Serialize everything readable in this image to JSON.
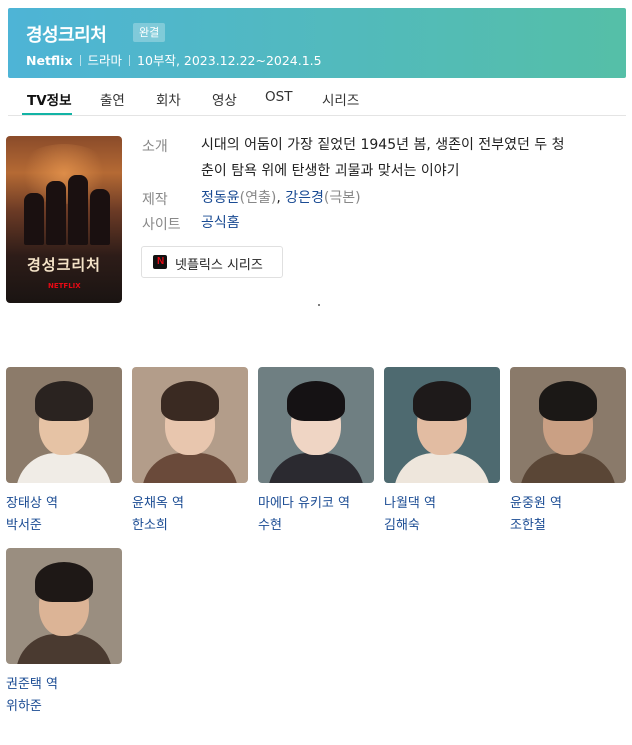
{
  "header": {
    "title": "경성크리처",
    "badge": "완결",
    "platform": "Netflix",
    "genre": "드라마",
    "info": "10부작, 2023.12.22~2024.1.5"
  },
  "tabs": [
    "TV정보",
    "출연",
    "회차",
    "영상",
    "OST",
    "시리즈"
  ],
  "poster": {
    "title": "경성크리처",
    "brand": "NETFLIX"
  },
  "details": {
    "intro_label": "소개",
    "intro_line1": "시대의 어둠이 가장 짙었던 1945년 봄, 생존이 전부였던 두 청",
    "intro_line2": "춘이 탐욕 위에 탄생한 괴물과 맞서는 이야기",
    "crew_label": "제작",
    "director": "정동윤",
    "director_role": "(연출)",
    "comma": ", ",
    "writer": "강은경",
    "writer_role": "(극본)",
    "site_label": "사이트",
    "site_link": "공식홈"
  },
  "netflix_button": {
    "icon_letter": "N",
    "label": "넷플릭스 시리즈"
  },
  "cast": [
    {
      "role": "장태상 역",
      "actor": "박서준"
    },
    {
      "role": "윤채옥 역",
      "actor": "한소희"
    },
    {
      "role": "마에다 유키코 역",
      "actor": "수현"
    },
    {
      "role": "나월댁 역",
      "actor": "김해숙"
    },
    {
      "role": "윤중원 역",
      "actor": "조한철"
    },
    {
      "role": "권준택 역",
      "actor": "위하준"
    }
  ],
  "colors": {
    "accent": "#12b3a5",
    "link": "#1a4b93",
    "header_start": "#4eb4d6",
    "header_end": "#55bfa7"
  }
}
